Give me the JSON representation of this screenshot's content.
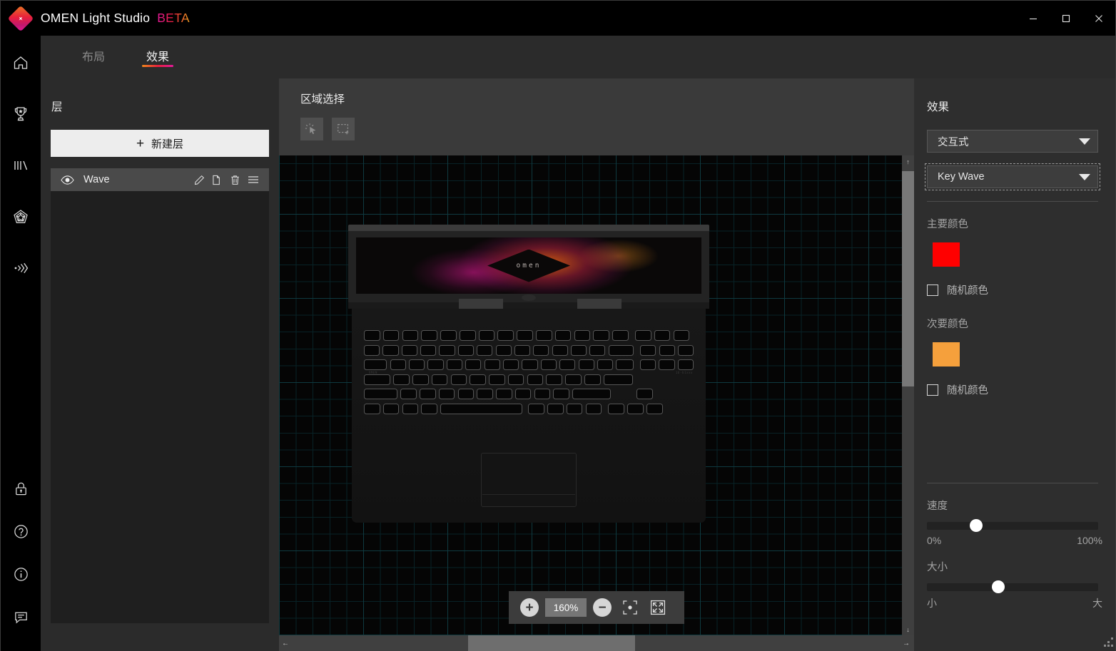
{
  "window": {
    "app_title": "OMEN Light Studio",
    "beta_badge": "BETA",
    "logo_icon": "omen-diamond-logo",
    "minimize_label": "–",
    "maximize_label": "□",
    "close_label": "✕"
  },
  "rail": {
    "items": [
      {
        "icon": "home-icon",
        "name": "home"
      },
      {
        "icon": "trophy-icon",
        "name": "rewards"
      },
      {
        "icon": "bars-icon",
        "name": "performance"
      },
      {
        "icon": "pentagon-star-icon",
        "name": "gaming-hub"
      },
      {
        "icon": "sound-waves-icon",
        "name": "audio"
      }
    ],
    "bottom_items": [
      {
        "icon": "lock-icon",
        "name": "key-lock"
      },
      {
        "icon": "question-circle-icon",
        "name": "help"
      },
      {
        "icon": "info-circle-icon",
        "name": "about"
      },
      {
        "icon": "chat-bubble-icon",
        "name": "feedback"
      }
    ]
  },
  "tabs": [
    {
      "label": "布局",
      "active": false
    },
    {
      "label": "效果",
      "active": true
    }
  ],
  "layers": {
    "title": "层",
    "new_layer_label": "新建层",
    "new_layer_icon": "plus-icon",
    "rows": [
      {
        "name": "Wave",
        "visibility_icon": "eye-icon",
        "edit_icon": "pencil-icon",
        "duplicate_icon": "copy-icon",
        "delete_icon": "trash-icon",
        "menu_icon": "hamburger-icon"
      }
    ]
  },
  "canvas": {
    "title": "区域选择",
    "tools": [
      {
        "icon": "click-select-icon",
        "name": "click-select-tool"
      },
      {
        "icon": "marquee-select-icon",
        "name": "marquee-select-tool"
      }
    ],
    "device": {
      "logo_text": "omen",
      "left_badge": "OMEN",
      "right_badge": "16-b1xxx"
    },
    "zoombar": {
      "zoom_in_label": "+",
      "zoom_level": "160%",
      "zoom_out_label": "−",
      "center_icon": "focus-center-icon",
      "fit_icon": "fit-screen-icon"
    },
    "scroll": {
      "up_arrow": "↑",
      "down_arrow": "↓",
      "left_arrow": "←",
      "right_arrow": "→"
    }
  },
  "effects": {
    "title": "效果",
    "mode_select": "交互式",
    "effect_select": "Key Wave",
    "primary_color_label": "主要颜色",
    "primary_color": "#FF0000",
    "primary_random_label": "随机颜色",
    "secondary_color_label": "次要颜色",
    "secondary_color": "#F5A03C",
    "secondary_random_label": "随机颜色",
    "speed_label": "速度",
    "speed_min": "0%",
    "speed_max": "100%",
    "speed_value_pct": 27,
    "size_label": "大小",
    "size_min": "小",
    "size_max": "大",
    "size_value_pct": 41
  },
  "theme": {
    "accent_orange": "#F08A1C",
    "accent_red": "#E8203C",
    "accent_magenta": "#E3199B",
    "panel_bg": "#2B2B2B",
    "canvas_bg": "#3A3A3A",
    "grid_line": "#0F3A40"
  }
}
